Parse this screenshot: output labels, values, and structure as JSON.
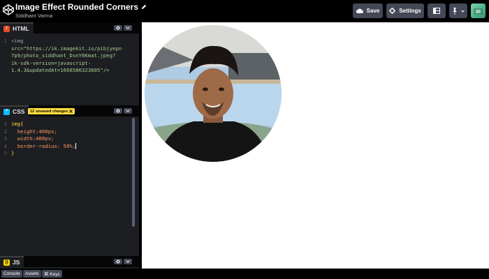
{
  "header": {
    "title": "Image Effect Rounded Corners",
    "author": "Siddhant Varma",
    "save_label": "Save",
    "settings_label": "Settings"
  },
  "editors": {
    "html": {
      "label": "HTML",
      "icon": "html-icon",
      "lines": [
        {
          "n": "1",
          "text": "<img"
        },
        {
          "n": "",
          "text": "src=\"https://ik.imagekit.io/pibjyepn"
        },
        {
          "n": "",
          "text": "7p9/photo_siddhant_DsnY6Kmat.jpeg?"
        },
        {
          "n": "",
          "text": "ik-sdk-version=javascript-"
        },
        {
          "n": "",
          "text": "1.4.3&updatedAt=1666586323605\"/>"
        }
      ]
    },
    "css": {
      "label": "CSS",
      "icon": "css-icon",
      "unsaved_count": "12",
      "unsaved_label": "unsaved changes",
      "lines": [
        {
          "n": "1",
          "text": "img{"
        },
        {
          "n": "2",
          "text": "  height:400px;"
        },
        {
          "n": "3",
          "text": "  width:400px;"
        },
        {
          "n": "4",
          "text": "  border-radius: 50%;"
        },
        {
          "n": "5",
          "text": "}"
        }
      ]
    },
    "js": {
      "label": "JS",
      "icon": "js-icon"
    }
  },
  "footer": {
    "console_label": "Console",
    "assets_label": "Assets",
    "keys_label": "⌘ Keys"
  },
  "colors": {
    "accent_yellow": "#ffdd40",
    "html_icon": "#e44d26",
    "css_icon": "#0ebeff",
    "js_icon": "#fcd000",
    "button_bg": "#444857",
    "editor_bg": "#1d1e22"
  }
}
